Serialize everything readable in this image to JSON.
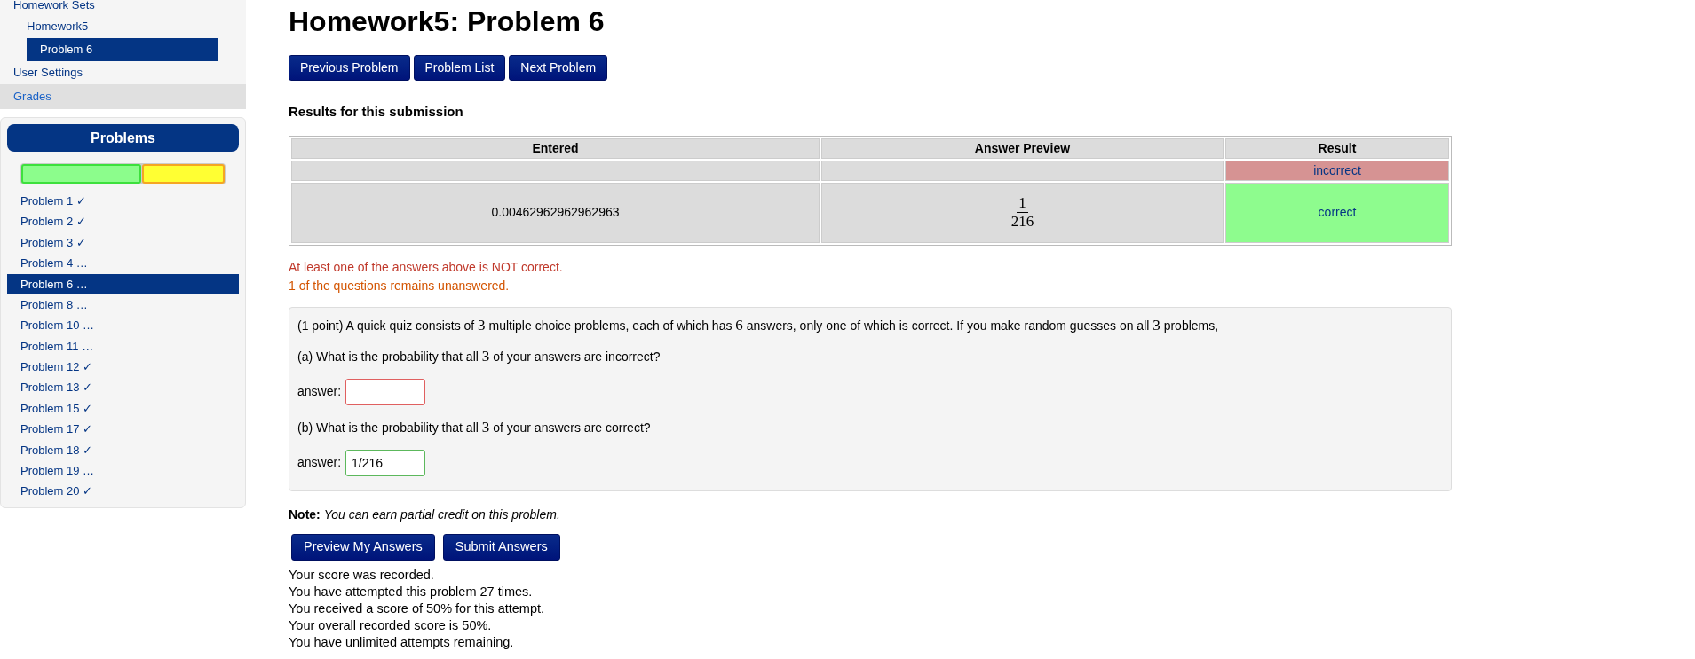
{
  "sidebar": {
    "nav": [
      {
        "label": "Homework Sets",
        "kind": "top",
        "selected": false
      },
      {
        "label": "Homework5",
        "kind": "sub",
        "selected": false
      },
      {
        "label": "Problem 6",
        "kind": "sub",
        "selected": true
      },
      {
        "label": "User Settings",
        "kind": "top",
        "selected": false
      },
      {
        "label": "Grades",
        "kind": "band",
        "selected": false
      }
    ],
    "problems": {
      "title": "Problems",
      "progress": [
        {
          "kind": "correct",
          "level": 0.59
        },
        {
          "kind": "incorrect",
          "level": 0.41
        }
      ],
      "items": [
        {
          "label": "Problem 1 ✓",
          "selected": false
        },
        {
          "label": "Problem 2 ✓",
          "selected": false
        },
        {
          "label": "Problem 3 ✓",
          "selected": false
        },
        {
          "label": "Problem 4 …",
          "selected": false
        },
        {
          "label": "Problem 6 …",
          "selected": true
        },
        {
          "label": "Problem 8 …",
          "selected": false
        },
        {
          "label": "Problem 10 …",
          "selected": false
        },
        {
          "label": "Problem 11 …",
          "selected": false
        },
        {
          "label": "Problem 12 ✓",
          "selected": false
        },
        {
          "label": "Problem 13 ✓",
          "selected": false
        },
        {
          "label": "Problem 15 ✓",
          "selected": false
        },
        {
          "label": "Problem 17 ✓",
          "selected": false
        },
        {
          "label": "Problem 18 ✓",
          "selected": false
        },
        {
          "label": "Problem 19 …",
          "selected": false
        },
        {
          "label": "Problem 20 ✓",
          "selected": false
        }
      ]
    }
  },
  "title": "Homework5: Problem 6",
  "nav_buttons": [
    "Previous Problem",
    "Problem List",
    "Next Problem"
  ],
  "results": {
    "heading": "Results for this submission",
    "columns": [
      "Entered",
      "Answer Preview",
      "Result"
    ],
    "rows": [
      {
        "result": "incorrect",
        "correct": false
      },
      {
        "entered": "0.00462962962962963",
        "preview": {
          "numerator": "1",
          "denominator": "216"
        },
        "result": "correct",
        "correct": true
      }
    ]
  },
  "messages": [
    {
      "text": "At least one of the answers above is NOT correct.",
      "color": "#c0392b"
    },
    {
      "text": "1 of the questions remains unanswered.",
      "color": "#d35400"
    }
  ],
  "problem": {
    "intro": [
      {
        "kind": "text",
        "text": "(1 point) A quick quiz consists of "
      },
      {
        "kind": "math",
        "text": "3"
      },
      {
        "kind": "text",
        "text": " multiple choice problems, each of which has "
      },
      {
        "kind": "math",
        "text": "6"
      },
      {
        "kind": "text",
        "text": " answers, only one of which is correct. If you make random guesses on all "
      },
      {
        "kind": "math",
        "text": "3"
      },
      {
        "kind": "text",
        "text": " problems,"
      }
    ],
    "parts": [
      {
        "question": [
          {
            "kind": "text",
            "text": "(a)  What is the probability that all "
          },
          {
            "kind": "math",
            "text": "3"
          },
          {
            "kind": "text",
            "text": " of your answers are incorrect?"
          }
        ],
        "label": "answer:",
        "correct": false
      },
      {
        "question": [
          {
            "kind": "text",
            "text": "(b)  What is the probability that all "
          },
          {
            "kind": "math",
            "text": "3"
          },
          {
            "kind": "text",
            "text": " of your answers are correct?"
          }
        ],
        "label": "answer:",
        "value": "1/216",
        "correct": true
      }
    ]
  },
  "note": "**Note:** *You can earn partial credit on this problem.*",
  "submit_buttons": [
    "Preview My Answers",
    "Submit Answers"
  ],
  "score_lines": [
    "Your score was recorded.",
    "You have attempted this problem 27 times.",
    "You received a score of 50% for this attempt.",
    "Your overall recorded score is 50%.",
    "You have unlimited attempts remaining."
  ]
}
